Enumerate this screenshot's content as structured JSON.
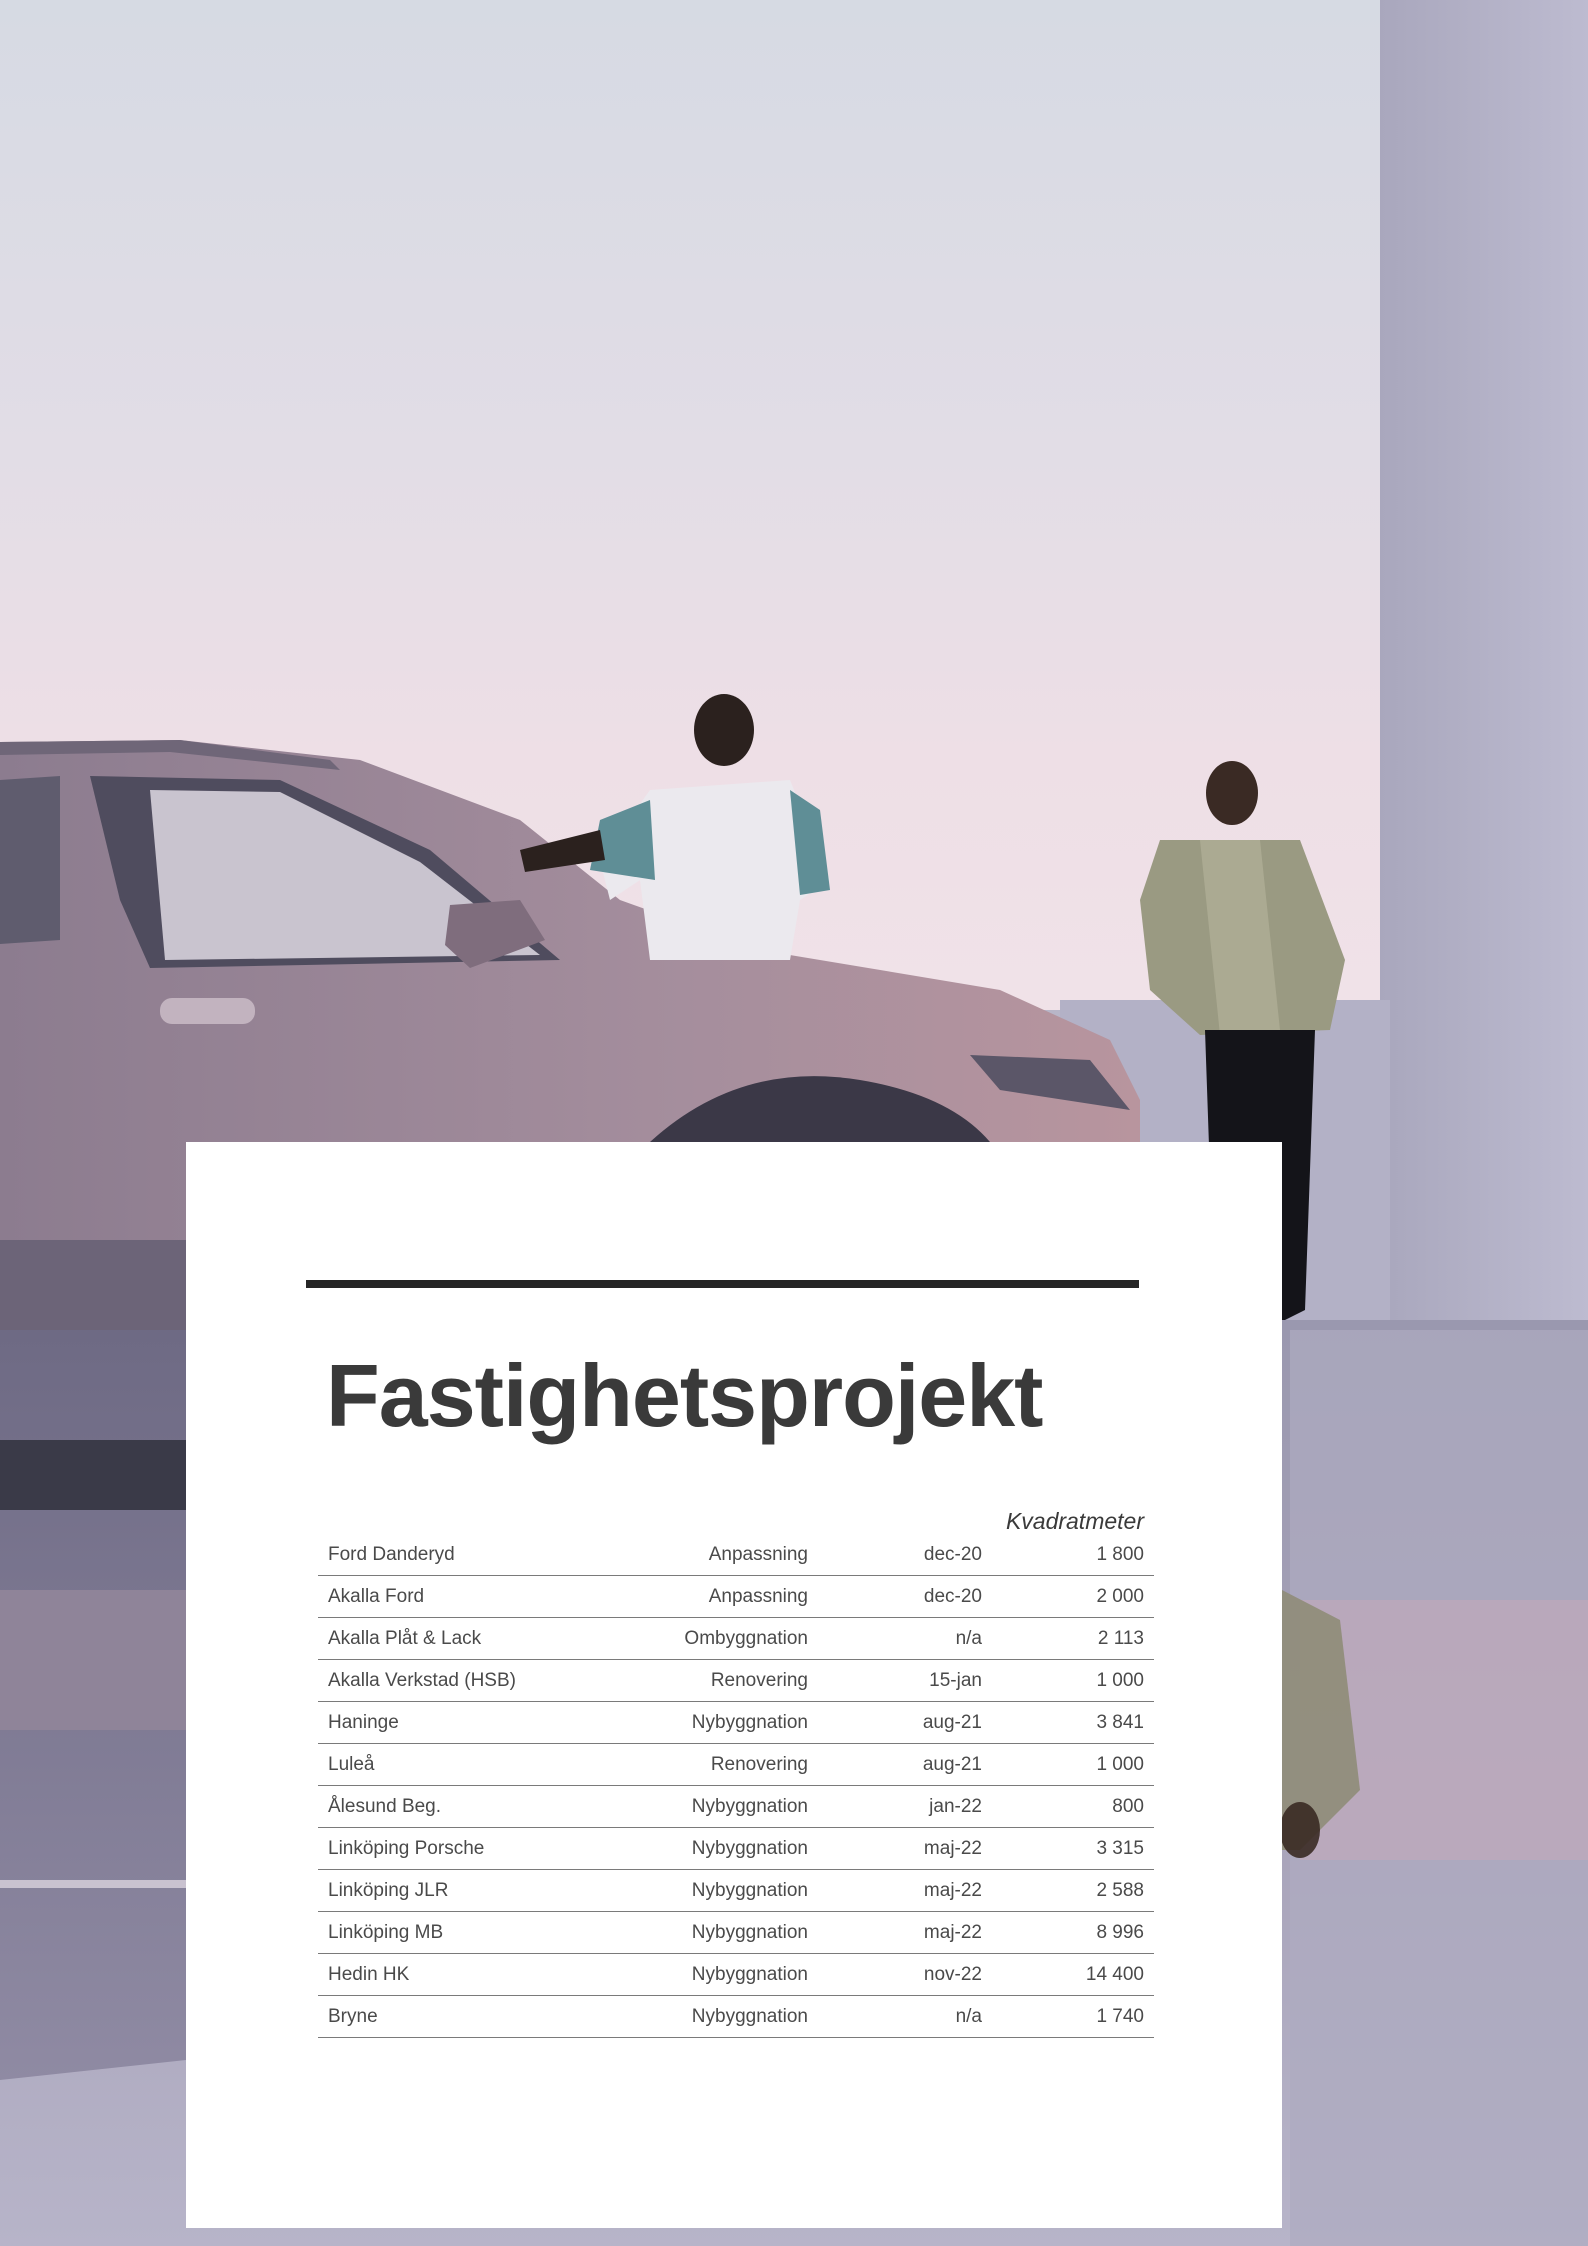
{
  "title": "Fastighetsprojekt",
  "unit_header": "Kvadratmeter",
  "projects": [
    {
      "name": "Ford Danderyd",
      "type": "Anpassning",
      "date": "dec-20",
      "sqm": "1 800"
    },
    {
      "name": "Akalla Ford",
      "type": "Anpassning",
      "date": "dec-20",
      "sqm": "2 000"
    },
    {
      "name": "Akalla Plåt & Lack",
      "type": "Ombyggnation",
      "date": "n/a",
      "sqm": "2 113"
    },
    {
      "name": "Akalla Verkstad (HSB)",
      "type": "Renovering",
      "date": "15-jan",
      "sqm": "1 000"
    },
    {
      "name": "Haninge",
      "type": "Nybyggnation",
      "date": "aug-21",
      "sqm": "3 841"
    },
    {
      "name": "Luleå",
      "type": "Renovering",
      "date": "aug-21",
      "sqm": "1 000"
    },
    {
      "name": "Ålesund Beg.",
      "type": "Nybyggnation",
      "date": "jan-22",
      "sqm": "800"
    },
    {
      "name": "Linköping Porsche",
      "type": "Nybyggnation",
      "date": "maj-22",
      "sqm": "3 315"
    },
    {
      "name": "Linköping JLR",
      "type": "Nybyggnation",
      "date": "maj-22",
      "sqm": "2 588"
    },
    {
      "name": "Linköping MB",
      "type": "Nybyggnation",
      "date": "maj-22",
      "sqm": "8 996"
    },
    {
      "name": "Hedin HK",
      "type": "Nybyggnation",
      "date": "nov-22",
      "sqm": "14 400"
    },
    {
      "name": "Bryne",
      "type": "Nybyggnation",
      "date": "n/a",
      "sqm": "1 740"
    }
  ]
}
